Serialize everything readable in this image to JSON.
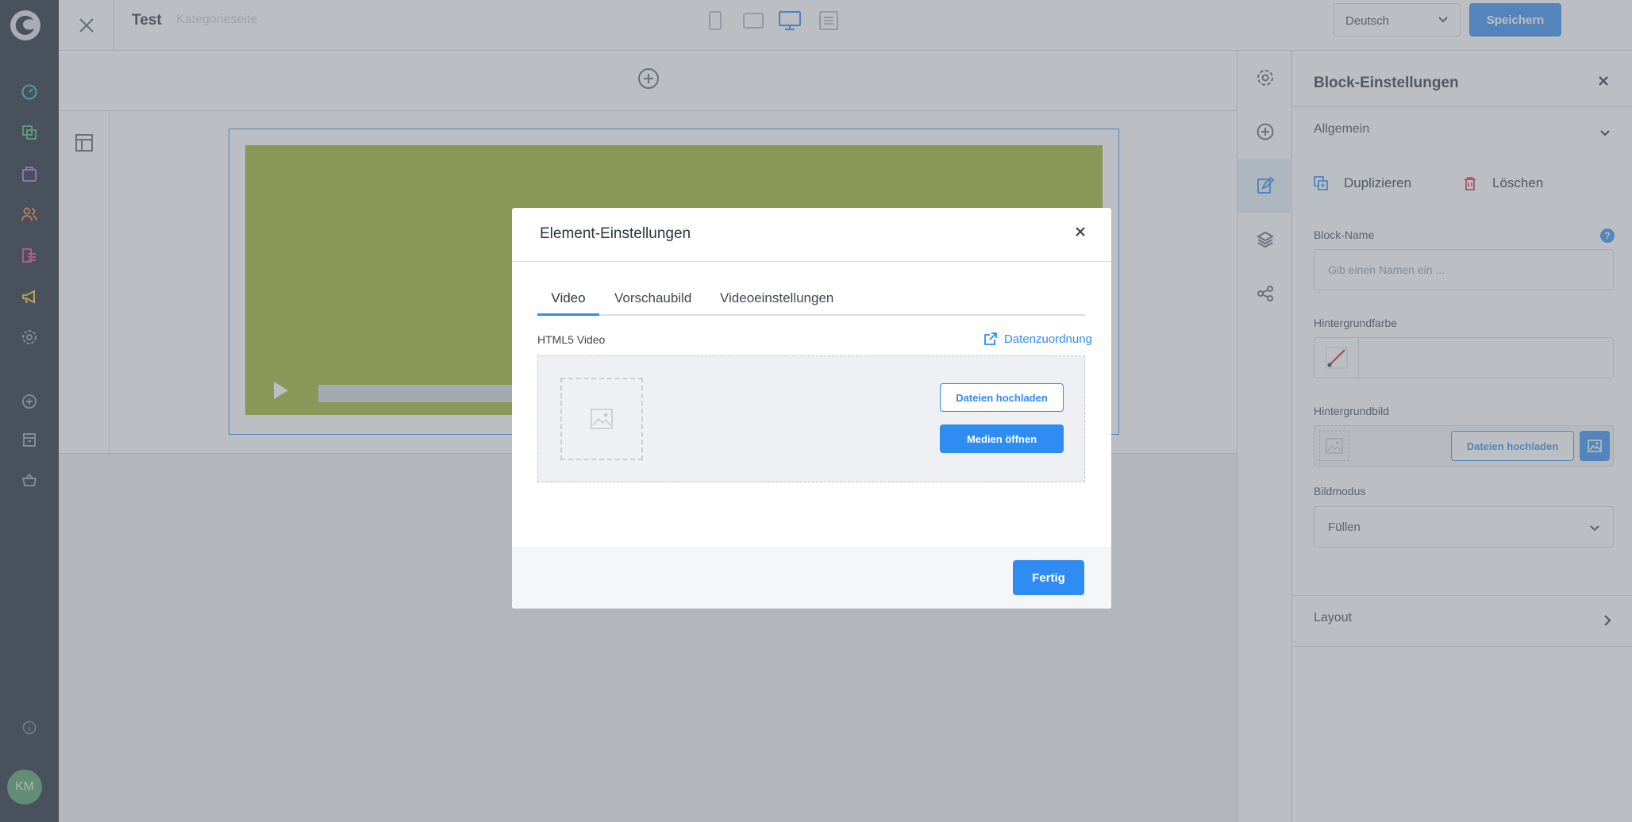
{
  "topbar": {
    "title": "Test",
    "subtitle": "Kategorieseite",
    "language": "Deutsch",
    "save_label": "Speichern"
  },
  "nav": {
    "avatar_initials": "KM"
  },
  "panel": {
    "title": "Block-Einstellungen",
    "general_label": "Allgemein",
    "duplicate_label": "Duplizieren",
    "delete_label": "Löschen",
    "block_name_label": "Block-Name",
    "block_name_placeholder": "Gib einen Namen ein ...",
    "help_glyph": "?",
    "bg_color_label": "Hintergrundfarbe",
    "bg_image_label": "Hintergrundbild",
    "bg_upload_label": "Dateien hochladen",
    "image_mode_label": "Bildmodus",
    "image_mode_value": "Füllen",
    "layout_label": "Layout"
  },
  "modal": {
    "title": "Element-Einstellungen",
    "tabs": [
      {
        "label": "Video"
      },
      {
        "label": "Vorschaubild"
      },
      {
        "label": "Videoeinstellungen"
      }
    ],
    "field_label": "HTML5 Video",
    "data_mapping_label": "Datenzuordnung",
    "upload_label": "Dateien hochladen",
    "open_media_label": "Medien öffnen",
    "done_label": "Fertig"
  },
  "colors": {
    "accent": "#2f8cf3",
    "nav_bg": "#1b2532",
    "video_bg": "#9bb229",
    "overlay": "rgba(120,126,134,0.50)"
  }
}
